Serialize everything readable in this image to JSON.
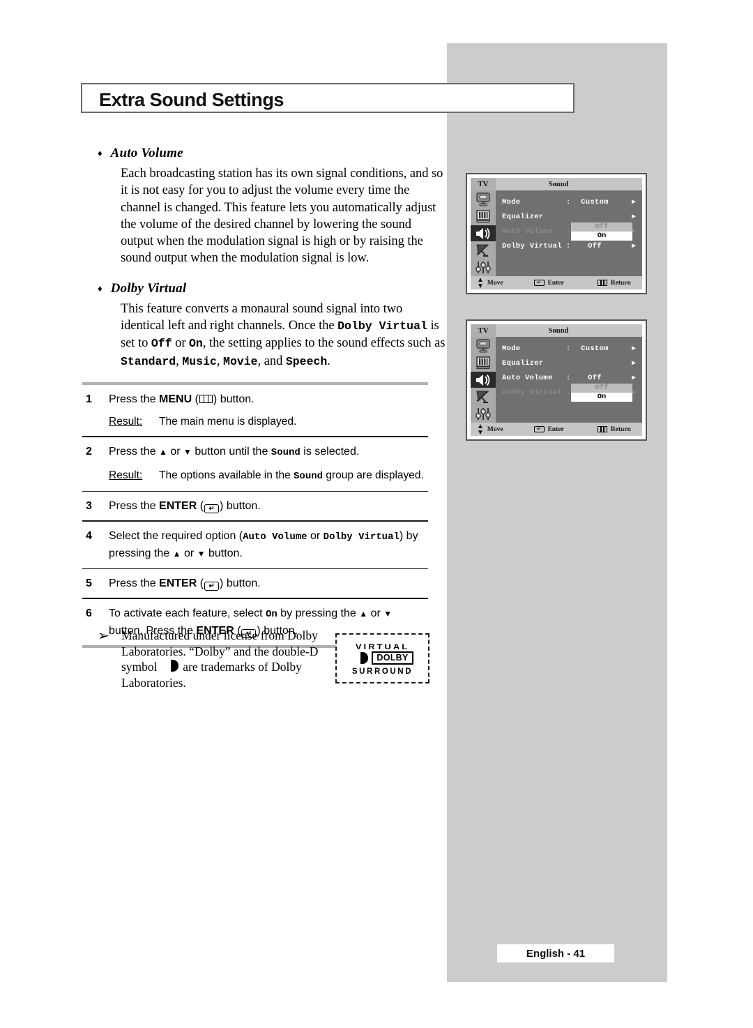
{
  "page": {
    "title": "Extra Sound Settings",
    "footer": "English - 41"
  },
  "sections": [
    {
      "bullet": "♦",
      "heading": "Auto Volume",
      "body": "Each broadcasting station has its own signal conditions, and so it is not easy for you to adjust the volume every time the channel is changed. This feature lets you automatically adjust the volume of the desired channel by lowering the sound output when the modulation signal is high or by raising the sound output when the modulation signal is low."
    },
    {
      "bullet": "♦",
      "heading": "Dolby Virtual",
      "body_part1": "This feature converts a monaural sound signal into two identical left and right channels. Once the ",
      "term_dolby_virtual": "Dolby Virtual",
      "body_part2": " is set to ",
      "term_off": "Off",
      "body_part3": " or ",
      "term_on": "On",
      "body_part4": ", the setting applies to the sound effects such as ",
      "term_standard": "Standard",
      "term_music": "Music",
      "term_movie": "Movie",
      "body_part5": ", and ",
      "term_speech": "Speech",
      "body_part6": "."
    }
  ],
  "steps": [
    {
      "num": "1",
      "pre": "Press the ",
      "key": "MENU",
      "post": " button.",
      "result_label": "Result:",
      "result_text": "The main menu is displayed."
    },
    {
      "num": "2",
      "pre": "Press the ",
      "mid": " button until the ",
      "term": "Sound",
      "post": " is selected.",
      "result_label": "Result:",
      "result_pre": "The options available in the ",
      "result_term": "Sound",
      "result_post": " group are displayed."
    },
    {
      "num": "3",
      "pre": "Press the ",
      "key": "ENTER",
      "post": " button."
    },
    {
      "num": "4",
      "pre": "Select the required option (",
      "term_a": "Auto Volume",
      "mid": " or ",
      "term_b": "Dolby Virtual",
      "post": ") by pressing the ",
      "tail": " button."
    },
    {
      "num": "5",
      "pre": "Press the ",
      "key": "ENTER",
      "post": " button."
    },
    {
      "num": "6",
      "pre": "To activate each feature, select ",
      "term": "On",
      "mid": " by pressing the ",
      "tail": " button. Press the ",
      "key": "ENTER",
      "end": " button."
    }
  ],
  "note": {
    "arrow": "➢",
    "line1": "Manufactured under license from Dolby",
    "line2": "Laboratories. “Dolby” and the double-D",
    "line3_pre": "symbol ",
    "line3_post": " are trademarks of Dolby",
    "line4": "Laboratories."
  },
  "dolby_logo": {
    "virtual": "VIRTUAL",
    "name": "DOLBY",
    "surround": "SURROUND"
  },
  "osd": {
    "colors": {
      "titlebar": "#c6c6c6",
      "body": "#707070",
      "sidebar": "#a8a8a8",
      "selected_icon": "#2a2a2a",
      "dropdown_off": "#bdbdbd",
      "dropdown_on": "#ffffff",
      "dim_text": "#8d8d8d"
    },
    "tv_label": "TV",
    "title": "Sound",
    "bottom": [
      {
        "icon": "updown-arrows-icon",
        "label": "Move"
      },
      {
        "icon": "enter-key-icon",
        "label": "Enter"
      },
      {
        "icon": "menu-key-icon",
        "label": "Return"
      }
    ],
    "sidebar_icons": [
      "picture-icon",
      "equalizer-icon",
      "sound-speaker-icon",
      "satellite-dish-icon",
      "setup-sliders-icon"
    ],
    "menu1": {
      "rows": [
        {
          "label": "Mode",
          "colon": ":",
          "value": "Custom",
          "arrow": "▶",
          "dim": false
        },
        {
          "label": "Equalizer",
          "colon": "",
          "value": "",
          "arrow": "▶",
          "dim": false
        },
        {
          "label": "Auto Volume",
          "colon": ":",
          "value": "Off",
          "arrow": "▶",
          "dim": true
        },
        {
          "label": "Dolby Virtual",
          "colon": ":",
          "value": "Off",
          "arrow": "▶",
          "dim": false
        }
      ],
      "dropdown": {
        "on_row": 2,
        "off": "Off",
        "on": "On"
      }
    },
    "menu2": {
      "rows": [
        {
          "label": "Mode",
          "colon": ":",
          "value": "Custom",
          "arrow": "▶",
          "dim": false
        },
        {
          "label": "Equalizer",
          "colon": "",
          "value": "",
          "arrow": "▶",
          "dim": false
        },
        {
          "label": "Auto Volume",
          "colon": ":",
          "value": "Off",
          "arrow": "▶",
          "dim": false
        },
        {
          "label": "Dolby Virtual",
          "colon": ":",
          "value": "Off",
          "arrow": "▶",
          "dim": true
        }
      ],
      "dropdown": {
        "on_row": 3,
        "off": "Off",
        "on": "On"
      }
    }
  }
}
